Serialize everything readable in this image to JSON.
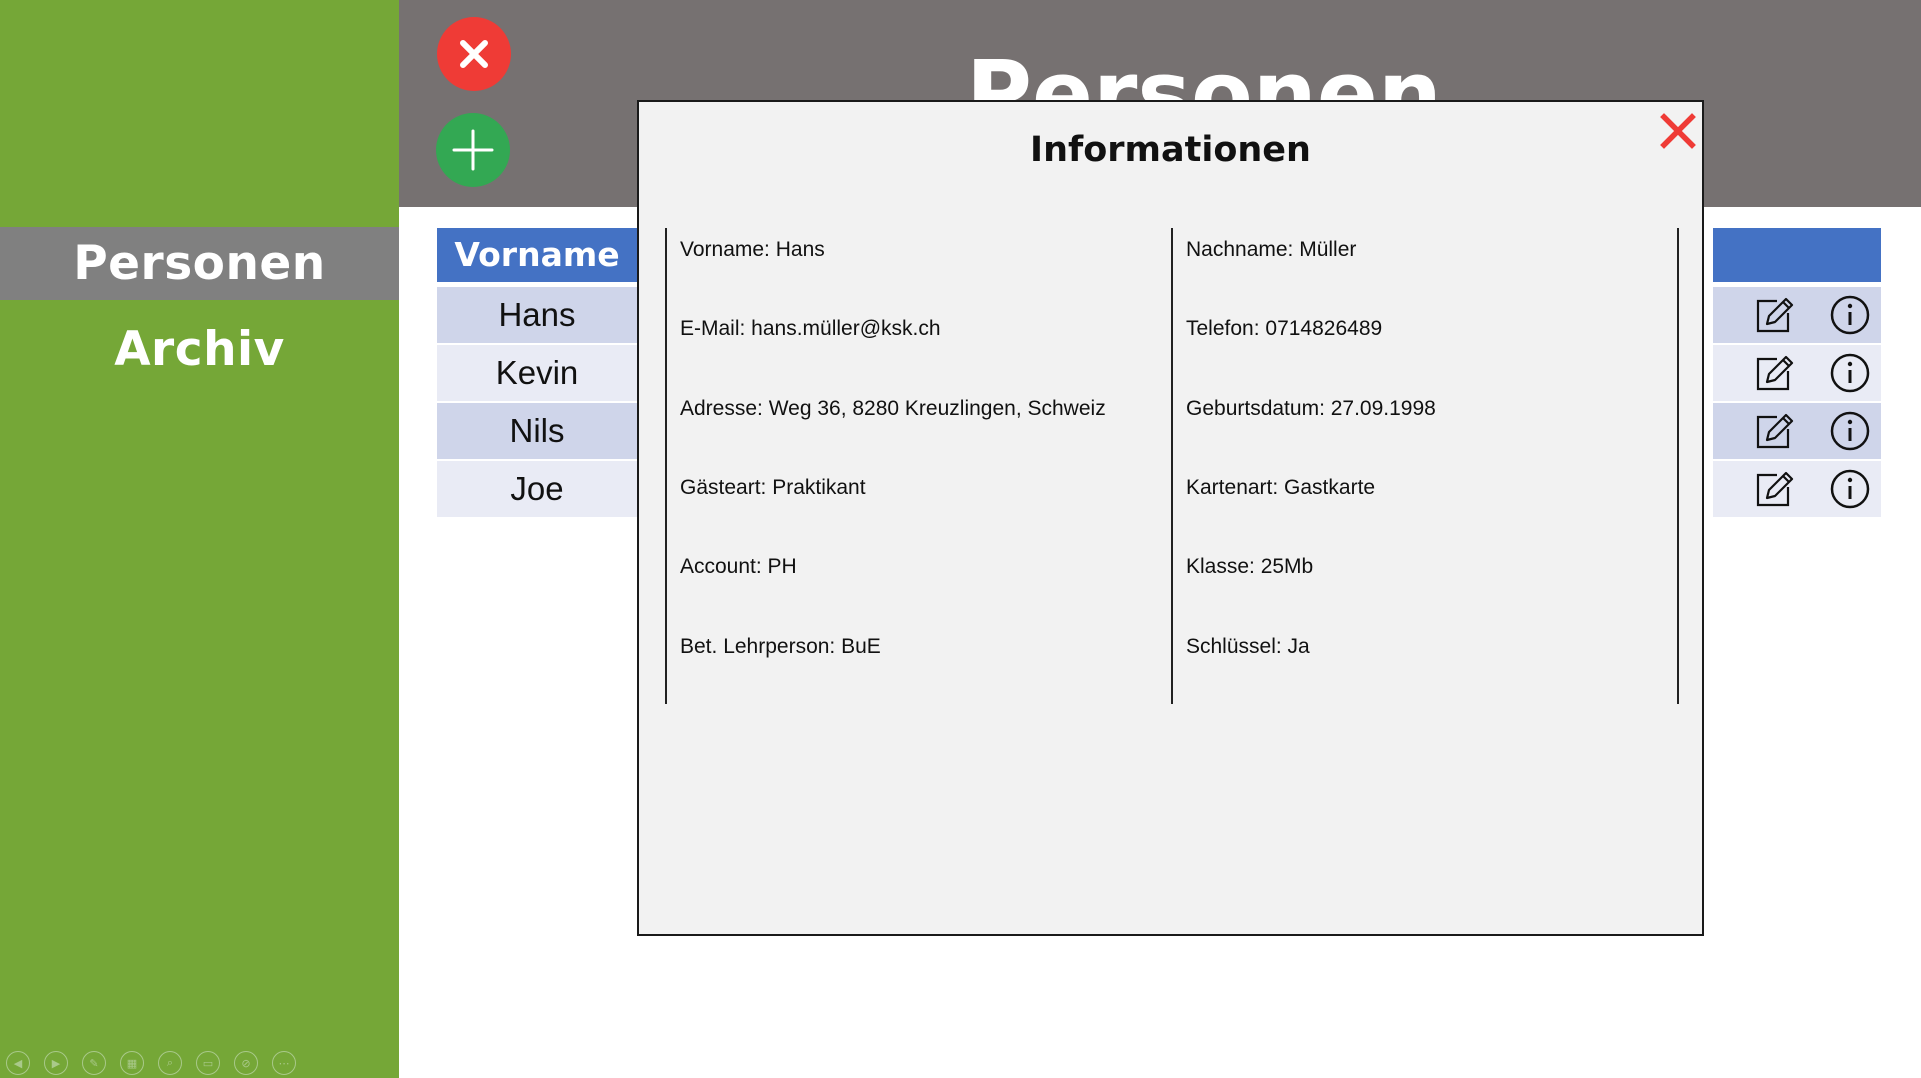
{
  "sidebar": {
    "items": [
      {
        "label": "Personen",
        "active": true
      },
      {
        "label": "Archiv",
        "active": false
      }
    ]
  },
  "header": {
    "title": "Personen"
  },
  "toolbar": {
    "close_icon": "close-icon",
    "add_icon": "plus-icon"
  },
  "table": {
    "headers": [
      "Vorname"
    ],
    "rows": [
      {
        "vorname": "Hans"
      },
      {
        "vorname": "Kevin"
      },
      {
        "vorname": "Nils"
      },
      {
        "vorname": "Joe"
      }
    ],
    "row_icons": [
      "edit-icon",
      "info-icon"
    ]
  },
  "modal": {
    "title": "Informationen",
    "left_fields": [
      "Vorname: Hans",
      "E-Mail: hans.müller@ksk.ch",
      "Adresse: Weg 36, 8280 Kreuzlingen, Schweiz",
      "Gästeart: Praktikant",
      "Account: PH",
      "Bet. Lehrperson: BuE"
    ],
    "right_fields": [
      "Nachname: Müller",
      "Telefon: 0714826489",
      "Geburtsdatum: 27.09.1998",
      "Kartenart: Gastkarte",
      "Klasse: 25Mb",
      "Schlüssel: Ja"
    ]
  },
  "colors": {
    "sidebar": "#75a737",
    "sidebar_active": "#808080",
    "header": "#767171",
    "table_header": "#4472c4",
    "row_dark": "#cfd5ea",
    "row_light": "#e9ebf5",
    "close_red": "#ef3b36",
    "add_green": "#33a853"
  }
}
